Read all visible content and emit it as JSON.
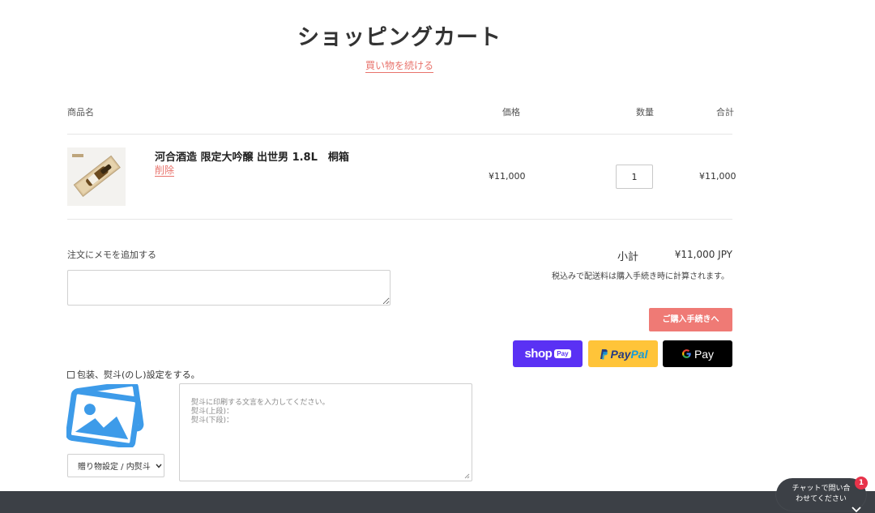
{
  "page": {
    "title": "ショッピングカート",
    "continue_shopping": "買い物を続ける"
  },
  "table": {
    "headers": {
      "product": "商品名",
      "price": "価格",
      "quantity": "数量",
      "total": "合計"
    }
  },
  "item": {
    "name": "河合酒造 限定大吟醸 出世男 1.8L　桐箱",
    "remove": "削除",
    "price": "¥11,000",
    "quantity": "1",
    "total": "¥11,000"
  },
  "note": {
    "label": "注文にメモを追加する"
  },
  "summary": {
    "subtotal_label": "小計",
    "subtotal_value": "¥11,000 JPY",
    "tax_note": "税込みで配送料は購入手続き時に計算されます。",
    "checkout": "ご購入手続きへ"
  },
  "payments": {
    "shop_pay": "shop",
    "shop_pay_tag": "Pay",
    "paypal_a": "Pay",
    "paypal_b": "Pal",
    "gpay": "Pay"
  },
  "gift": {
    "checkbox_label": "包装、熨斗(のし)設定をする。",
    "select_value": "贈り物設定 / 内熨斗",
    "textarea_placeholder": "熨斗に印刷する文言を入力してください。\n熨斗(上段)：\n熨斗(下段)："
  },
  "chat": {
    "label_line1": "チャットで問い合",
    "label_line2": "わせてください",
    "badge_count": "1"
  },
  "colors": {
    "accent": "#e8736c",
    "checkout": "#ef7a75",
    "shop_pay": "#5a31f4",
    "paypal": "#ffc439",
    "footer": "#3c4046",
    "placeholder_icon": "#3d9be9"
  }
}
